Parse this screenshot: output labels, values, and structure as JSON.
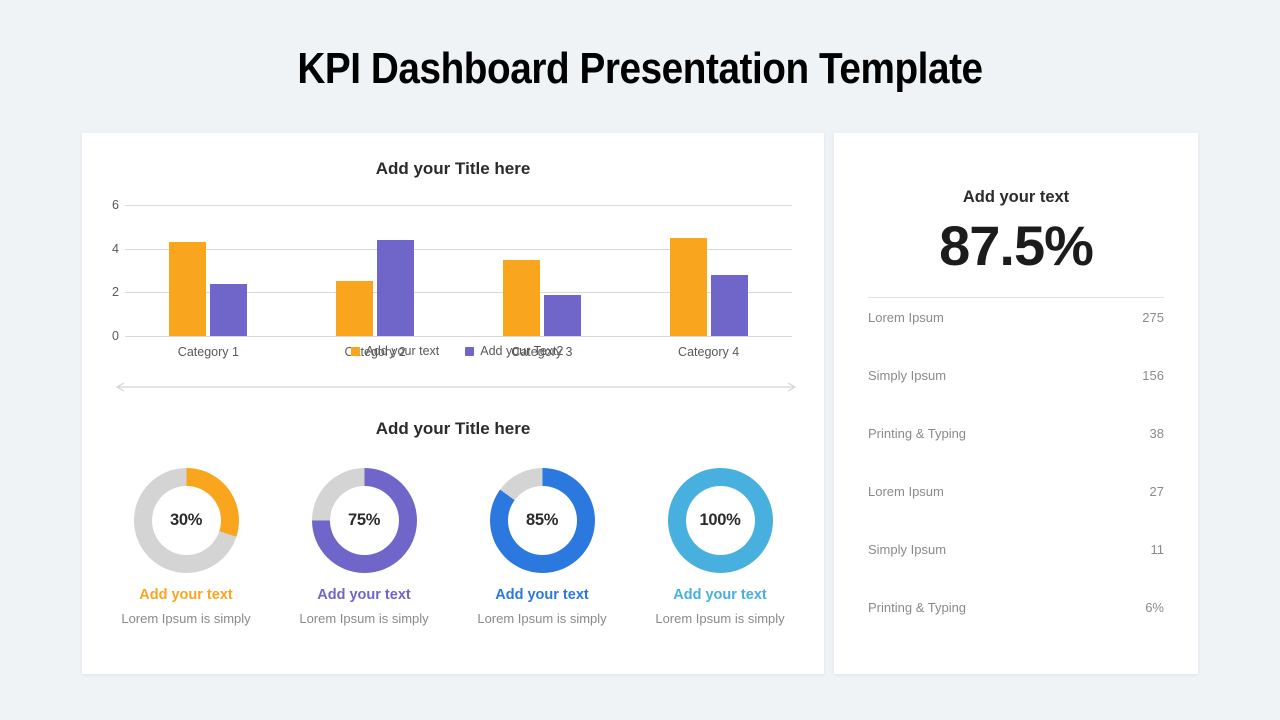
{
  "title": "KPI Dashboard Presentation Template",
  "bar_section": {
    "title": "Add your Title here"
  },
  "donut_section": {
    "title": "Add your Title here",
    "items": [
      {
        "percent": "30%",
        "heading": "Add your text",
        "caption": "Lorem Ipsum is simply",
        "color": "#f9a51e",
        "value": 30
      },
      {
        "percent": "75%",
        "heading": "Add your text",
        "caption": "Lorem Ipsum is simply",
        "color": "#7065c8",
        "value": 75
      },
      {
        "percent": "85%",
        "heading": "Add your text",
        "caption": "Lorem Ipsum is simply",
        "color": "#2b78de",
        "value": 85
      },
      {
        "percent": "100%",
        "heading": "Add your text",
        "caption": "Lorem Ipsum is simply",
        "color": "#47b0df",
        "value": 100
      }
    ],
    "track_color": "#d4d4d4"
  },
  "kpi_panel": {
    "heading": "Add your text",
    "value": "87.5%",
    "rows": [
      {
        "label": "Lorem Ipsum",
        "value": "275"
      },
      {
        "label": "Simply Ipsum",
        "value": "156"
      },
      {
        "label": "Printing & Typing",
        "value": "38"
      },
      {
        "label": "Lorem Ipsum",
        "value": "27"
      },
      {
        "label": "Simply Ipsum",
        "value": "11"
      },
      {
        "label": "Printing & Typing",
        "value": "6%"
      }
    ]
  },
  "chart_data": {
    "type": "bar",
    "title": "Add your Title here",
    "categories": [
      "Category 1",
      "Category 2",
      "Category 3",
      "Category 4"
    ],
    "series": [
      {
        "name": "Add your text",
        "color": "#f9a51e",
        "values": [
          4.3,
          2.5,
          3.5,
          4.5
        ]
      },
      {
        "name": "Add your Text2",
        "color": "#7065c8",
        "values": [
          2.4,
          4.4,
          1.9,
          2.8
        ]
      }
    ],
    "ylabel": "",
    "xlabel": "",
    "ylim": [
      0,
      6
    ],
    "yticks": [
      0,
      2,
      4,
      6
    ],
    "grid": true,
    "legend_position": "bottom"
  },
  "colors": {
    "background": "#eff3f6",
    "card": "#ffffff",
    "series1": "#f9a51e",
    "series2": "#7065c8",
    "donut3": "#2b78de",
    "donut4": "#47b0df",
    "track": "#d4d4d4"
  }
}
